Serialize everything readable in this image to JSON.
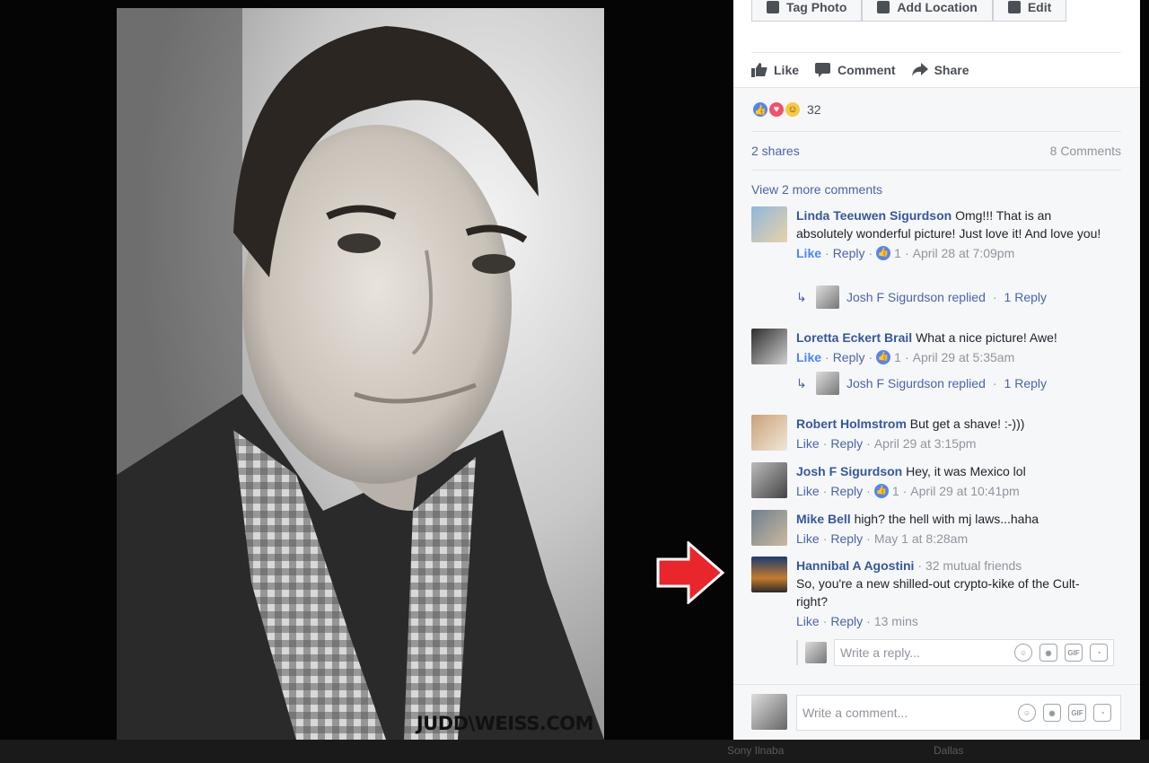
{
  "photo": {
    "watermark": "JUDD\\WEISS.COM"
  },
  "top_tools": [
    "Tag Photo",
    "Add Location",
    "Edit"
  ],
  "actions": {
    "like": "Like",
    "comment": "Comment",
    "share": "Share"
  },
  "reactions": {
    "count": "32"
  },
  "stats": {
    "shares": "2 shares",
    "comments": "8 Comments"
  },
  "view_more": "View 2 more comments",
  "comments": [
    {
      "author": "Linda Teeuwen Sigurdson",
      "text": "Omg!!! That is an absolutely wonderful picture! Just love it! And love you!",
      "like": "Like",
      "reply": "Reply",
      "likes": "1",
      "time": "April 28 at 7:09pm",
      "replied": "Josh F Sigurdson replied",
      "replies": "1 Reply"
    },
    {
      "author": "Loretta Eckert Brail",
      "text": "What a nice picture! Awe!",
      "like": "Like",
      "reply": "Reply",
      "likes": "1",
      "time": "April 29 at 5:35am",
      "replied": "Josh F Sigurdson replied",
      "replies": "1 Reply"
    },
    {
      "author": "Robert Holmstrom",
      "text": "But get a shave! :-)))",
      "like": "Like",
      "reply": "Reply",
      "time": "April 29 at 3:15pm"
    },
    {
      "author": "Josh F Sigurdson",
      "text": "Hey, it was Mexico lol",
      "like": "Like",
      "reply": "Reply",
      "likes": "1",
      "time": "April 29 at 10:41pm"
    },
    {
      "author": "Mike Bell",
      "text": "high? the hell with mj laws...haha",
      "like": "Like",
      "reply": "Reply",
      "time": "May 1 at 8:28am"
    },
    {
      "author": "Hannibal A Agostini",
      "mutual": "32 mutual friends",
      "text": "So, you're a new shilled-out crypto-kike of the Cult-right?",
      "like": "Like",
      "reply": "Reply",
      "time": "13 mins"
    }
  ],
  "reply_box": {
    "placeholder": "Write a reply..."
  },
  "composer": {
    "placeholder": "Write a comment..."
  },
  "tool_labels": {
    "gif": "GIF"
  },
  "bottom_bar": {
    "left_label": "Sony Ilnaba",
    "right_label": "Dallas"
  }
}
